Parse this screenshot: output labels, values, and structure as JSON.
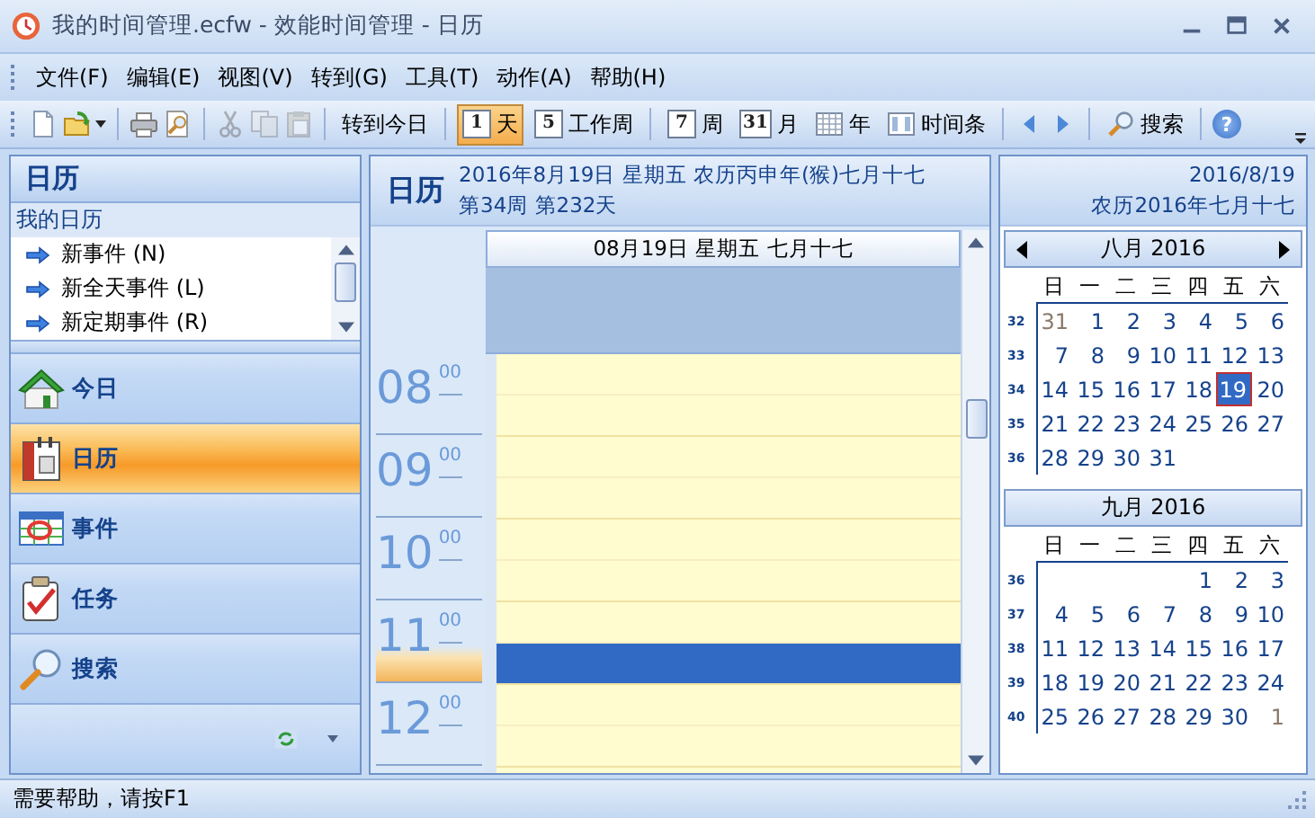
{
  "window": {
    "title": "我的时间管理.ecfw - 效能时间管理 - 日历"
  },
  "menu": [
    "文件(F)",
    "编辑(E)",
    "视图(V)",
    "转到(G)",
    "工具(T)",
    "动作(A)",
    "帮助(H)"
  ],
  "toolbar": [
    [
      {
        "kind": "new",
        "disabled": false
      },
      {
        "kind": "open",
        "disabled": false
      }
    ],
    [
      {
        "kind": "print",
        "disabled": false
      },
      {
        "kind": "preview",
        "disabled": false
      }
    ],
    [
      {
        "kind": "cut",
        "disabled": true
      },
      {
        "kind": "copy",
        "disabled": true
      },
      {
        "kind": "paste",
        "disabled": true
      }
    ],
    [
      {
        "kind": "text",
        "label": "转到今日"
      }
    ],
    [
      {
        "kind": "view",
        "icon_text": "1",
        "label": "天",
        "selected": true
      },
      {
        "kind": "view",
        "icon_text": "5",
        "label": "工作周",
        "selected": false
      }
    ],
    [
      {
        "kind": "view",
        "icon_text": "7",
        "label": "周",
        "selected": false
      },
      {
        "kind": "view",
        "icon_text": "31",
        "label": "月",
        "selected": false
      },
      {
        "kind": "year",
        "label": "年",
        "selected": false
      },
      {
        "kind": "timeline",
        "label": "时间条",
        "selected": false
      }
    ],
    [
      {
        "kind": "back"
      },
      {
        "kind": "forward"
      }
    ],
    [
      {
        "kind": "search",
        "label": "搜索"
      }
    ],
    [
      {
        "kind": "help",
        "icon_text": "?"
      }
    ]
  ],
  "sidebar": {
    "title": "日历",
    "section": "我的日历",
    "actions": [
      "新事件 (N)",
      "新全天事件 (L)",
      "新定期事件 (R)"
    ],
    "nav": [
      {
        "kind": "home",
        "label": "今日",
        "selected": false
      },
      {
        "kind": "calendar",
        "label": "日历",
        "selected": true
      },
      {
        "kind": "events",
        "label": "事件",
        "selected": false
      },
      {
        "kind": "task",
        "label": "任务",
        "selected": false
      },
      {
        "kind": "search",
        "label": "搜索",
        "selected": false
      }
    ]
  },
  "day_view": {
    "title": "日历",
    "date_line": "2016年8月19日 星期五 农历丙申年(猴)七月十七",
    "week_line": "第34周 第232天",
    "column_header": "08月19日 星期五 七月十七",
    "hours": [
      {
        "hour": "08",
        "minutes": "00",
        "now": false,
        "slots": [
          {
            "selected": false
          },
          {
            "selected": false
          }
        ]
      },
      {
        "hour": "09",
        "minutes": "00",
        "now": false,
        "slots": [
          {
            "selected": false
          },
          {
            "selected": false
          }
        ]
      },
      {
        "hour": "10",
        "minutes": "00",
        "now": false,
        "slots": [
          {
            "selected": false
          },
          {
            "selected": false
          }
        ]
      },
      {
        "hour": "11",
        "minutes": "00",
        "now": true,
        "slots": [
          {
            "selected": false
          },
          {
            "selected": true
          }
        ]
      },
      {
        "hour": "12",
        "minutes": "00",
        "now": false,
        "slots": [
          {
            "selected": false
          },
          {
            "selected": false
          }
        ]
      }
    ]
  },
  "mini_calendar": {
    "date": "2016/8/19",
    "lunar": "农历2016年七月十七",
    "months": [
      {
        "title": "八月 2016",
        "arrows": true,
        "weekdays": [
          "日",
          "一",
          "二",
          "三",
          "四",
          "五",
          "六"
        ],
        "weeks": [
          {
            "number": "32",
            "days": [
              {
                "day": "31",
                "other_month": true,
                "selected": false
              },
              {
                "day": "1",
                "other_month": false,
                "selected": false
              },
              {
                "day": "2",
                "other_month": false,
                "selected": false
              },
              {
                "day": "3",
                "other_month": false,
                "selected": false
              },
              {
                "day": "4",
                "other_month": false,
                "selected": false
              },
              {
                "day": "5",
                "other_month": false,
                "selected": false
              },
              {
                "day": "6",
                "other_month": false,
                "selected": false
              }
            ]
          },
          {
            "number": "33",
            "days": [
              {
                "day": "7",
                "other_month": false,
                "selected": false
              },
              {
                "day": "8",
                "other_month": false,
                "selected": false
              },
              {
                "day": "9",
                "other_month": false,
                "selected": false
              },
              {
                "day": "10",
                "other_month": false,
                "selected": false
              },
              {
                "day": "11",
                "other_month": false,
                "selected": false
              },
              {
                "day": "12",
                "other_month": false,
                "selected": false
              },
              {
                "day": "13",
                "other_month": false,
                "selected": false
              }
            ]
          },
          {
            "number": "34",
            "days": [
              {
                "day": "14",
                "other_month": false,
                "selected": false
              },
              {
                "day": "15",
                "other_month": false,
                "selected": false
              },
              {
                "day": "16",
                "other_month": false,
                "selected": false
              },
              {
                "day": "17",
                "other_month": false,
                "selected": false
              },
              {
                "day": "18",
                "other_month": false,
                "selected": false
              },
              {
                "day": "19",
                "other_month": false,
                "selected": true
              },
              {
                "day": "20",
                "other_month": false,
                "selected": false
              }
            ]
          },
          {
            "number": "35",
            "days": [
              {
                "day": "21",
                "other_month": false,
                "selected": false
              },
              {
                "day": "22",
                "other_month": false,
                "selected": false
              },
              {
                "day": "23",
                "other_month": false,
                "selected": false
              },
              {
                "day": "24",
                "other_month": false,
                "selected": false
              },
              {
                "day": "25",
                "other_month": false,
                "selected": false
              },
              {
                "day": "26",
                "other_month": false,
                "selected": false
              },
              {
                "day": "27",
                "other_month": false,
                "selected": false
              }
            ]
          },
          {
            "number": "36",
            "days": [
              {
                "day": "28",
                "other_month": false,
                "selected": false
              },
              {
                "day": "29",
                "other_month": false,
                "selected": false
              },
              {
                "day": "30",
                "other_month": false,
                "selected": false
              },
              {
                "day": "31",
                "other_month": false,
                "selected": false
              }
            ]
          }
        ]
      },
      {
        "title": "九月 2016",
        "arrows": false,
        "weekdays": [
          "日",
          "一",
          "二",
          "三",
          "四",
          "五",
          "六"
        ],
        "weeks": [
          {
            "number": "36",
            "days": [
              {
                "day": "1",
                "other_month": false,
                "selected": false
              },
              {
                "day": "2",
                "other_month": false,
                "selected": false
              },
              {
                "day": "3",
                "other_month": false,
                "selected": false
              }
            ]
          },
          {
            "number": "37",
            "days": [
              {
                "day": "4",
                "other_month": false,
                "selected": false
              },
              {
                "day": "5",
                "other_month": false,
                "selected": false
              },
              {
                "day": "6",
                "other_month": false,
                "selected": false
              },
              {
                "day": "7",
                "other_month": false,
                "selected": false
              },
              {
                "day": "8",
                "other_month": false,
                "selected": false
              },
              {
                "day": "9",
                "other_month": false,
                "selected": false
              },
              {
                "day": "10",
                "other_month": false,
                "selected": false
              }
            ]
          },
          {
            "number": "38",
            "days": [
              {
                "day": "11",
                "other_month": false,
                "selected": false
              },
              {
                "day": "12",
                "other_month": false,
                "selected": false
              },
              {
                "day": "13",
                "other_month": false,
                "selected": false
              },
              {
                "day": "14",
                "other_month": false,
                "selected": false
              },
              {
                "day": "15",
                "other_month": false,
                "selected": false
              },
              {
                "day": "16",
                "other_month": false,
                "selected": false
              },
              {
                "day": "17",
                "other_month": false,
                "selected": false
              }
            ]
          },
          {
            "number": "39",
            "days": [
              {
                "day": "18",
                "other_month": false,
                "selected": false
              },
              {
                "day": "19",
                "other_month": false,
                "selected": false
              },
              {
                "day": "20",
                "other_month": false,
                "selected": false
              },
              {
                "day": "21",
                "other_month": false,
                "selected": false
              },
              {
                "day": "22",
                "other_month": false,
                "selected": false
              },
              {
                "day": "23",
                "other_month": false,
                "selected": false
              },
              {
                "day": "24",
                "other_month": false,
                "selected": false
              }
            ]
          },
          {
            "number": "40",
            "days": [
              {
                "day": "25",
                "other_month": false,
                "selected": false
              },
              {
                "day": "26",
                "other_month": false,
                "selected": false
              },
              {
                "day": "27",
                "other_month": false,
                "selected": false
              },
              {
                "day": "28",
                "other_month": false,
                "selected": false
              },
              {
                "day": "29",
                "other_month": false,
                "selected": false
              },
              {
                "day": "30",
                "other_month": false,
                "selected": false
              },
              {
                "day": "1",
                "other_month": true,
                "selected": false
              }
            ]
          }
        ]
      }
    ]
  },
  "status_bar": {
    "text": "需要帮助，请按F1"
  }
}
